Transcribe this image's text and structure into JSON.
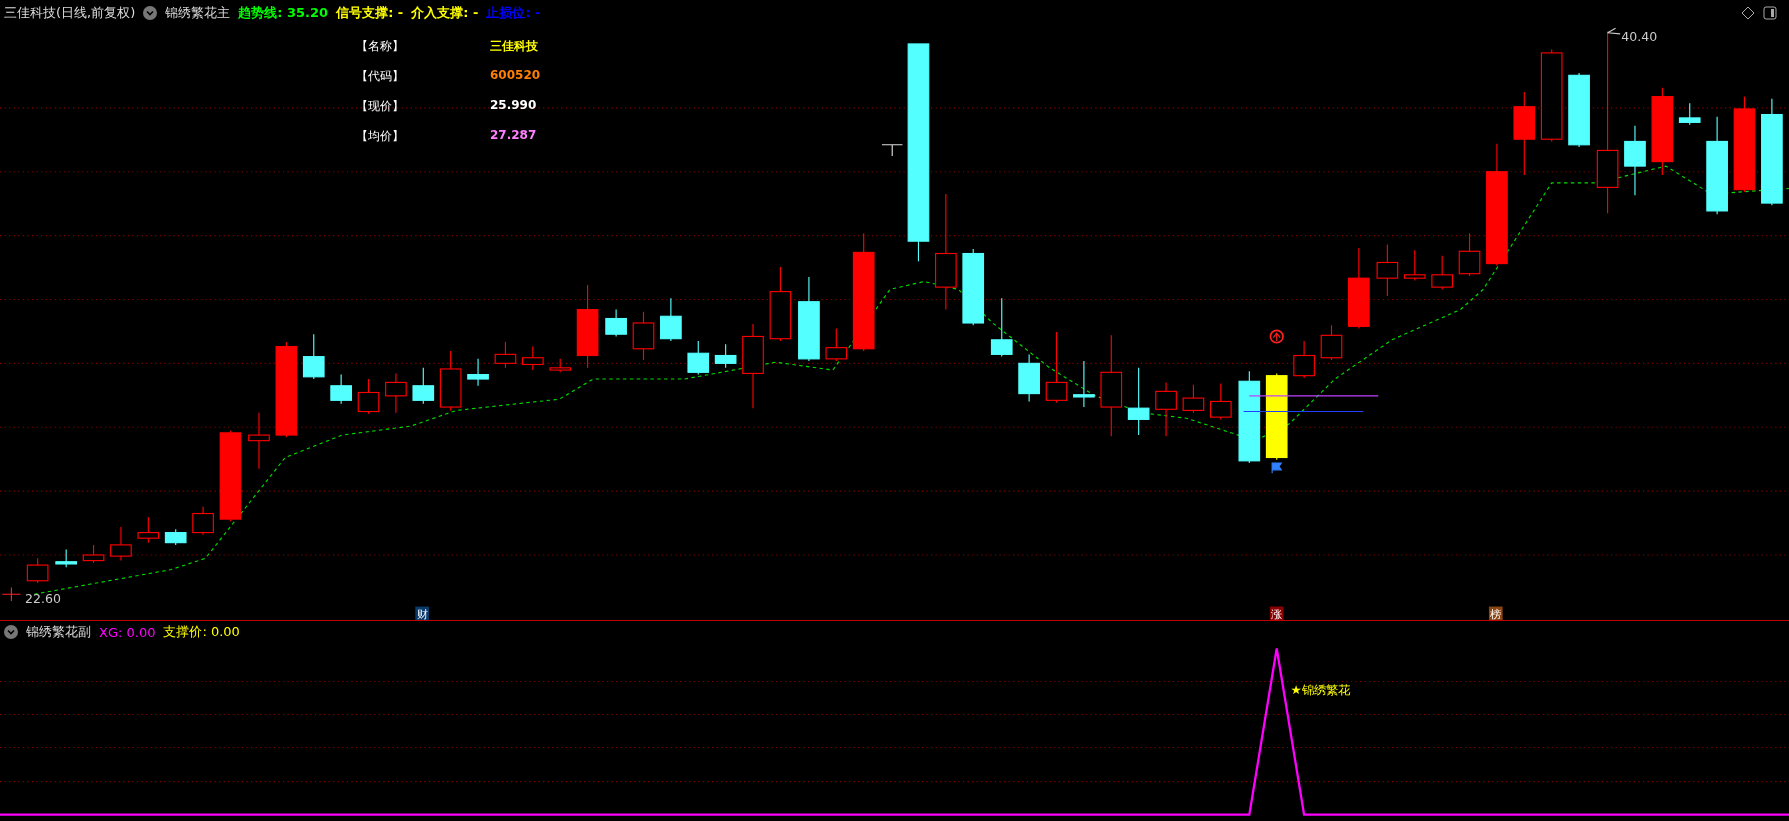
{
  "header": {
    "title": "三佳科技(日线,前复权)",
    "indicator": "锦绣繁花主",
    "values": [
      {
        "text": "趋势线: 35.20",
        "color": "#00ff00"
      },
      {
        "text": "信号支撑: -",
        "color": "#ffff00"
      },
      {
        "text": "介入支撑: -",
        "color": "#ffff00"
      },
      {
        "text": "止损位: -",
        "color": "#0000ff"
      }
    ]
  },
  "info": [
    {
      "label": "【名称】",
      "value": "三佳科技",
      "color": "#ffff00"
    },
    {
      "label": "【代码】",
      "value": "600520",
      "color": "#ff8000"
    },
    {
      "label": "【现价】",
      "value": "25.990",
      "color": "#ffffff"
    },
    {
      "label": "【均价】",
      "value": "27.287",
      "color": "#ff80ff"
    }
  ],
  "chart": {
    "high_label": "40.40",
    "low_label": "22.60",
    "markers": [
      {
        "text": "财",
        "color": "#0a3a6a"
      },
      {
        "text": "涨",
        "color": "#8b0000"
      },
      {
        "text": "榜",
        "color": "#8b4513"
      }
    ]
  },
  "sub": {
    "indicator": "锦绣繁花副",
    "values": [
      {
        "text": "XG: 0.00",
        "color": "#ff00ff"
      },
      {
        "text": "支撑价: 0.00",
        "color": "#ffff00"
      }
    ],
    "annotation": "★锦绣繁花"
  }
}
